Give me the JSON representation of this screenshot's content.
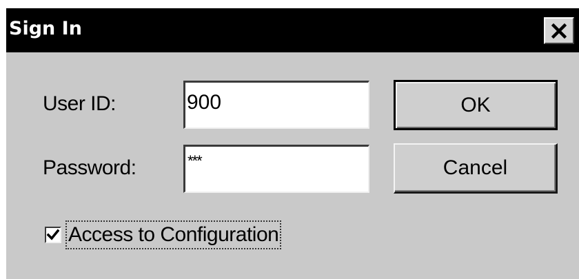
{
  "window": {
    "title": "Sign In",
    "close_icon": "close-icon"
  },
  "form": {
    "user_id_label": "User ID:",
    "user_id_value": "900",
    "password_label": "Password:",
    "password_value": "***"
  },
  "buttons": {
    "ok_label": "OK",
    "cancel_label": "Cancel"
  },
  "options": {
    "access_config_label": "Access to Configuration",
    "access_config_checked": true,
    "check_icon": "checkmark-icon"
  }
}
